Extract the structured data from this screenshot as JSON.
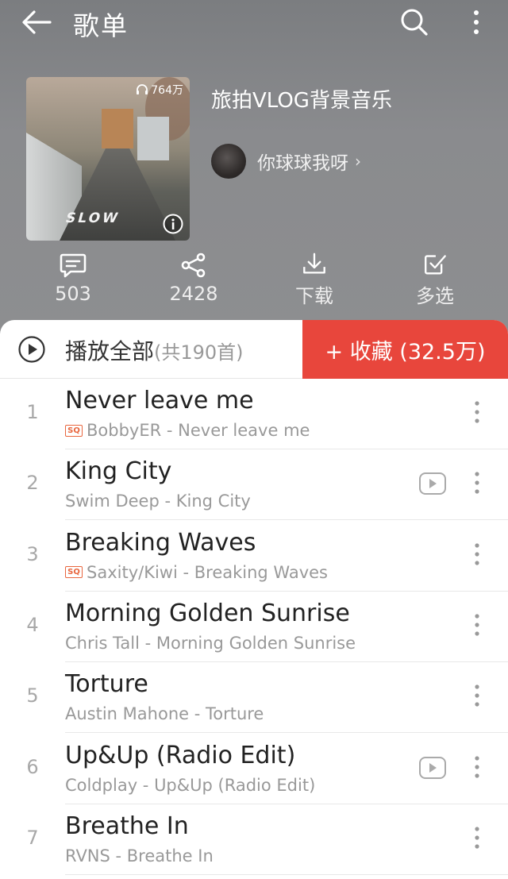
{
  "header": {
    "title": "歌单",
    "back_icon": "arrow-left-icon",
    "search_icon": "search-icon",
    "more_icon": "more-vertical-icon"
  },
  "playlist": {
    "title": "旅拍VLOG背景音乐",
    "play_count": "764万",
    "creator": "你球球我呀",
    "creator_chevron": "›",
    "cover_text": "SLOW"
  },
  "actions": [
    {
      "icon": "comment-icon",
      "label": "503"
    },
    {
      "icon": "share-icon",
      "label": "2428"
    },
    {
      "icon": "download-icon",
      "label": "下载"
    },
    {
      "icon": "multi-select-icon",
      "label": "多选"
    }
  ],
  "play_all": {
    "label": "播放全部",
    "count": "(共190首)"
  },
  "collect": {
    "label": "+ 收藏 (32.5万)",
    "color": "#e8463c"
  },
  "songs": [
    {
      "num": "1",
      "title": "Never leave me",
      "sq": true,
      "artist_album": "BobbyER - Never leave me",
      "mv": false
    },
    {
      "num": "2",
      "title": "King City",
      "sq": false,
      "artist_album": "Swim Deep - King City",
      "mv": true
    },
    {
      "num": "3",
      "title": "Breaking Waves",
      "sq": true,
      "artist_album": "Saxity/Kiwi - Breaking Waves",
      "mv": false
    },
    {
      "num": "4",
      "title": "Morning Golden Sunrise",
      "sq": false,
      "artist_album": "Chris Tall - Morning Golden Sunrise",
      "mv": false
    },
    {
      "num": "5",
      "title": "Torture",
      "sq": false,
      "artist_album": "Austin Mahone - Torture",
      "mv": false
    },
    {
      "num": "6",
      "title": "Up&Up (Radio Edit)",
      "sq": false,
      "artist_album": "Coldplay - Up&Up (Radio Edit)",
      "mv": true
    },
    {
      "num": "7",
      "title": "Breathe In",
      "sq": false,
      "artist_album": "RVNS - Breathe In",
      "mv": false
    }
  ],
  "sq_badge": "SQ"
}
